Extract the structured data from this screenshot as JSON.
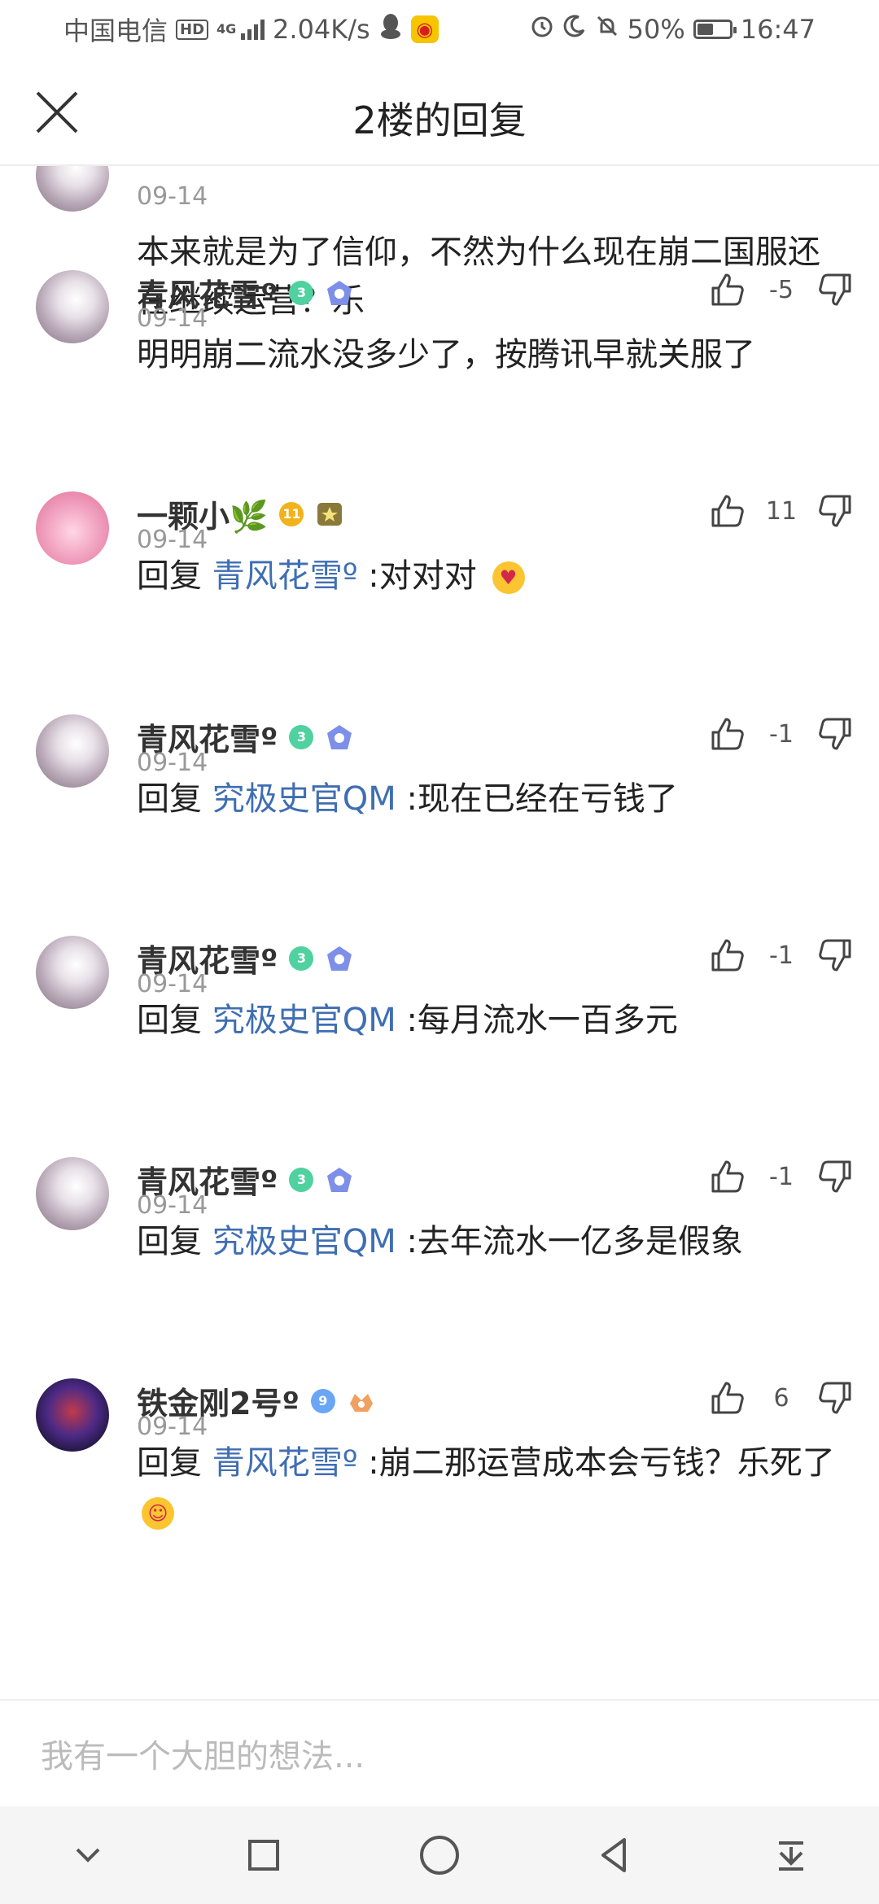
{
  "status_bar": {
    "carrier": "中国电信",
    "hd": "HD",
    "network": "4G",
    "speed": "2.04K/s",
    "battery": "50%",
    "battery_level": 0.5,
    "time": "16:47",
    "icons": [
      "qq-icon",
      "weibo-icon",
      "alarm-icon",
      "moon-icon",
      "mute-icon"
    ]
  },
  "header": {
    "title": "2楼的回复",
    "close_icon": "close-icon"
  },
  "comments": [
    {
      "username": "",
      "level": "",
      "date": "09-14",
      "text": "本来就是为了信仰，不然为什么现在崩二国服还在继续运营？乐",
      "score": "",
      "avatar": "snow"
    },
    {
      "username": "青风花雪º",
      "level": "3",
      "date": "09-14",
      "text": "明明崩二流水没多少了，按腾讯早就关服了",
      "score": "-5",
      "avatar": "snow"
    },
    {
      "username": "一颗小🌿",
      "level": "11",
      "date": "09-14",
      "reply_prefix": "回复",
      "reply_to": "青风花雪º",
      "text": ":对对对",
      "score": "11",
      "avatar": "pink",
      "emoji": "heart-eyes"
    },
    {
      "username": "青风花雪º",
      "level": "3",
      "date": "09-14",
      "reply_prefix": "回复",
      "reply_to": "究极史官QM",
      "text": ":现在已经在亏钱了",
      "score": "-1",
      "avatar": "snow"
    },
    {
      "username": "青风花雪º",
      "level": "3",
      "date": "09-14",
      "reply_prefix": "回复",
      "reply_to": "究极史官QM",
      "text": ":每月流水一百多元",
      "score": "-1",
      "avatar": "snow"
    },
    {
      "username": "青风花雪º",
      "level": "3",
      "date": "09-14",
      "reply_prefix": "回复",
      "reply_to": "究极史官QM",
      "text": ":去年流水一亿多是假象",
      "score": "-1",
      "avatar": "snow"
    },
    {
      "username": "铁金刚2号º",
      "level": "9",
      "date": "09-14",
      "reply_prefix": "回复",
      "reply_to": "青风花雪º",
      "text": ":崩二那运营成本会亏钱？乐死了",
      "score": "6",
      "avatar": "dark",
      "emoji": "laugh"
    }
  ],
  "input": {
    "placeholder": "我有一个大胆的想法..."
  },
  "nav_bar": {
    "buttons": [
      "chevron-down-icon",
      "square-icon",
      "circle-icon",
      "back-triangle-icon",
      "download-icon"
    ]
  },
  "colors": {
    "mention": "#3f6eb3",
    "level_green": "#4fd1a0",
    "level_gold": "#f2b21b",
    "level_blue": "#6aa6f5"
  }
}
